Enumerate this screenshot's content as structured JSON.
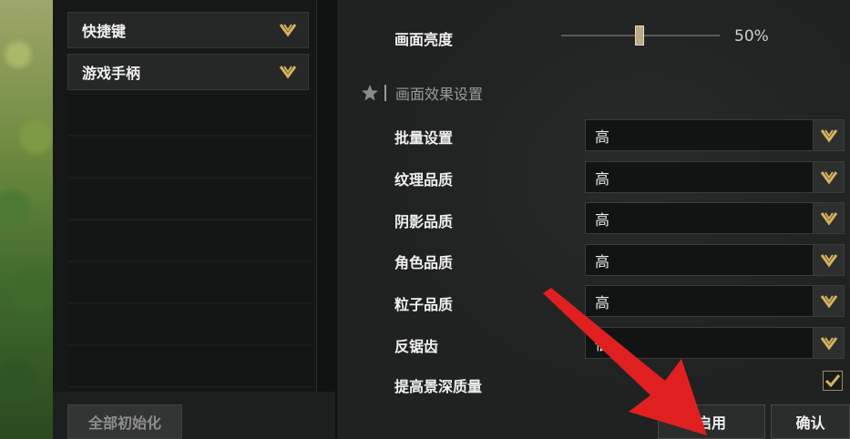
{
  "left_menu": {
    "items": [
      {
        "label": "快捷键"
      },
      {
        "label": "游戏手柄"
      }
    ],
    "reset_label": "全部初始化"
  },
  "brightness": {
    "label": "画面亮度",
    "value_text": "50%",
    "level_percent": 50
  },
  "section": {
    "title": "画面效果设置"
  },
  "settings": [
    {
      "label": "批量设置",
      "value": "高"
    },
    {
      "label": "纹理品质",
      "value": "高"
    },
    {
      "label": "阴影品质",
      "value": "高"
    },
    {
      "label": "角色品质",
      "value": "高"
    },
    {
      "label": "粒子品质",
      "value": "高"
    },
    {
      "label": "反锯齿",
      "value": "低"
    }
  ],
  "depth": {
    "label": "提高景深质量",
    "checked": true
  },
  "buttons": {
    "apply_label": "启用",
    "confirm_label": "确认"
  },
  "colors": {
    "accent_gold": "#d8b25a",
    "annotation_red": "#e02020"
  },
  "icons": [
    "chevron-down-icon",
    "star-icon",
    "checkmark-icon",
    "arrow-annotation-icon"
  ]
}
